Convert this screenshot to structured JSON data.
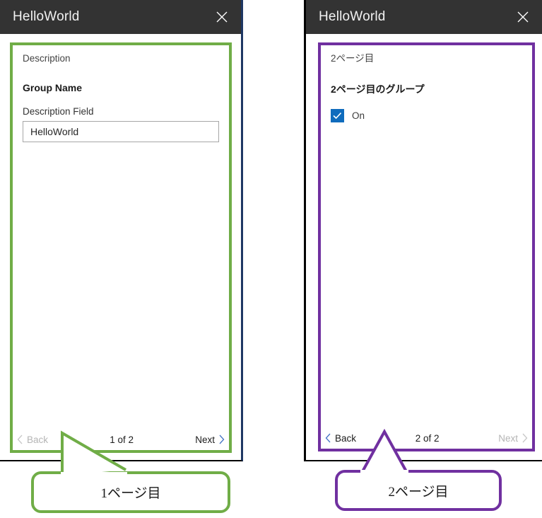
{
  "window_left": {
    "title": "HelloWorld",
    "close_icon": "close-icon",
    "page": {
      "caption": "Description",
      "group_header": "Group Name",
      "field_label": "Description Field",
      "field_value": "HelloWorld",
      "field_placeholder": ""
    },
    "nav": {
      "back_label": "Back",
      "back_enabled": false,
      "counter": "1 of 2",
      "next_label": "Next",
      "next_enabled": true
    },
    "highlight_color": "#70ad47"
  },
  "window_right": {
    "title": "HelloWorld",
    "close_icon": "close-icon",
    "page": {
      "caption": "2ページ目",
      "group_header": "2ページ目のグループ",
      "checkbox_label": "On",
      "checkbox_checked": true,
      "checkbox_color": "#0f6cbd"
    },
    "nav": {
      "back_label": "Back",
      "back_enabled": true,
      "counter": "2 of 2",
      "next_label": "Next",
      "next_enabled": false
    },
    "highlight_color": "#7030a0"
  },
  "callouts": {
    "left": {
      "text": "1ページ目",
      "color": "#70ad47"
    },
    "right": {
      "text": "2ページ目",
      "color": "#7030a0"
    }
  }
}
